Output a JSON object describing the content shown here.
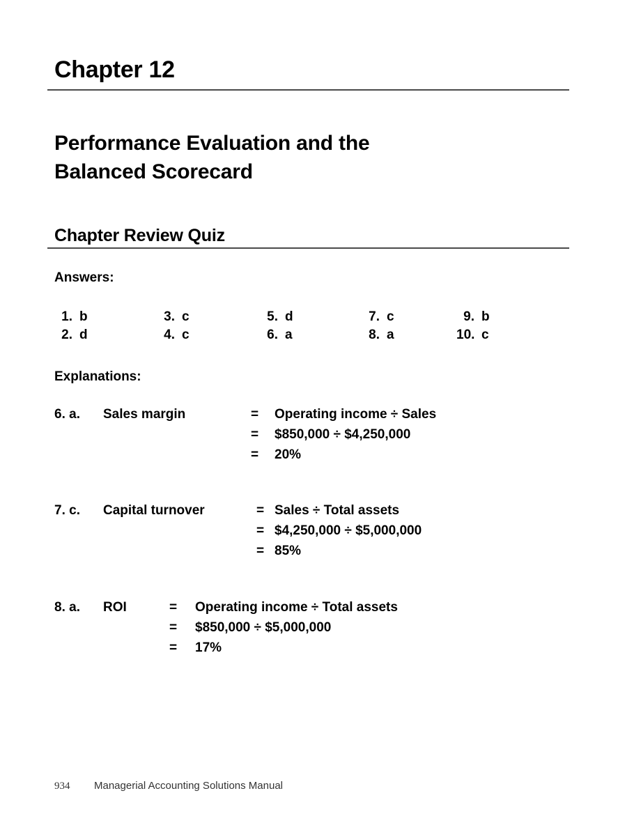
{
  "document": {
    "chapter_title": "Chapter 12",
    "chapter_heading_line1": "Performance Evaluation and the",
    "chapter_heading_line2": "Balanced Scorecard",
    "section_heading": "Chapter Review Quiz",
    "rule_color": "#4a4a4a"
  },
  "answers": {
    "label": "Answers:",
    "columns": [
      {
        "items": [
          {
            "num": "1.",
            "val": "b"
          },
          {
            "num": "2.",
            "val": "d"
          }
        ]
      },
      {
        "items": [
          {
            "num": "3.",
            "val": "c"
          },
          {
            "num": "4.",
            "val": "c"
          }
        ]
      },
      {
        "items": [
          {
            "num": "5.",
            "val": "d"
          },
          {
            "num": "6.",
            "val": "a"
          }
        ]
      },
      {
        "items": [
          {
            "num": "7.",
            "val": "c"
          },
          {
            "num": "8.",
            "val": "a"
          }
        ]
      },
      {
        "items": [
          {
            "num": "9.",
            "val": "b"
          },
          {
            "num": "10.",
            "val": "c"
          }
        ]
      }
    ]
  },
  "explanations": {
    "label": "Explanations:",
    "blocks": [
      {
        "num": "6. a.",
        "label": "Sales margin",
        "lines": [
          {
            "eq": "=",
            "val": "Operating income ÷ Sales"
          },
          {
            "eq": "=",
            "val": "$850,000 ÷ $4,250,000"
          },
          {
            "eq": "=",
            "val": "20%"
          }
        ]
      },
      {
        "num": "7. c.",
        "label": "Capital turnover",
        "lines": [
          {
            "eq": "=",
            "val": "Sales ÷ Total assets"
          },
          {
            "eq": "=",
            "val": "$4,250,000 ÷ $5,000,000"
          },
          {
            "eq": "=",
            "val": "85%"
          }
        ]
      },
      {
        "num": "8. a.",
        "label": "ROI",
        "lines": [
          {
            "eq": "=",
            "val": "Operating income ÷ Total assets"
          },
          {
            "eq": "=",
            "val": "$850,000 ÷ $5,000,000"
          },
          {
            "eq": "=",
            "val": "17%"
          }
        ]
      }
    ]
  },
  "footer": {
    "page_number": "934",
    "title": "Managerial Accounting Solutions Manual"
  }
}
